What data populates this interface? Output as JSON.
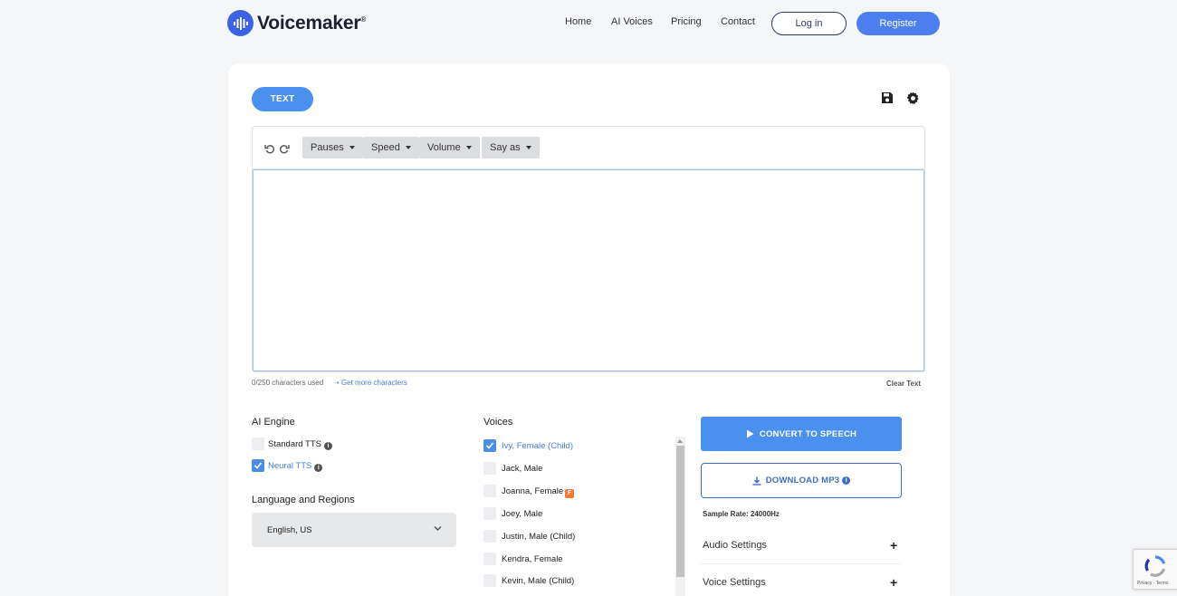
{
  "brand": {
    "name": "Voicemaker",
    "registered": "®",
    "color": "#3a63e8"
  },
  "nav": {
    "items": [
      "Home",
      "AI Voices",
      "Pricing",
      "Contact"
    ],
    "login": "Log in",
    "register": "Register"
  },
  "tabs": {
    "active": "TEXT"
  },
  "toolbar": {
    "dropdowns": [
      "Pauses",
      "Speed",
      "Volume",
      "Say as"
    ]
  },
  "editor": {
    "value": "",
    "chars_used": "0/250 characters used",
    "more_chars": "Get more characters",
    "clear": "Clear Text"
  },
  "engine": {
    "title": "AI Engine",
    "options": [
      {
        "label": "Standard TTS",
        "checked": false
      },
      {
        "label": "Neural TTS",
        "checked": true
      }
    ]
  },
  "language": {
    "title": "Language and Regions",
    "selected": "English, US"
  },
  "voices": {
    "title": "Voices",
    "items": [
      {
        "label": "Ivy, Female (Child)",
        "checked": true
      },
      {
        "label": "Jack, Male",
        "checked": false
      },
      {
        "label": "Joanna, Female",
        "checked": false,
        "badge": "F"
      },
      {
        "label": "Joey, Male",
        "checked": false
      },
      {
        "label": "Justin, Male (Child)",
        "checked": false
      },
      {
        "label": "Kendra, Female",
        "checked": false
      },
      {
        "label": "Kevin, Male (Child)",
        "checked": false
      }
    ]
  },
  "actions": {
    "convert": "CONVERT TO SPEECH",
    "download": "DOWNLOAD MP3",
    "sample_rate": "Sample Rate: 24000Hz"
  },
  "accordions": {
    "audio": "Audio Settings",
    "voice": "Voice Settings"
  },
  "recaptcha": {
    "text": "Privacy - Terms"
  },
  "colors": {
    "accent": "#4a90ee",
    "register": "#4d7ef0",
    "link": "#4a7ed9"
  }
}
